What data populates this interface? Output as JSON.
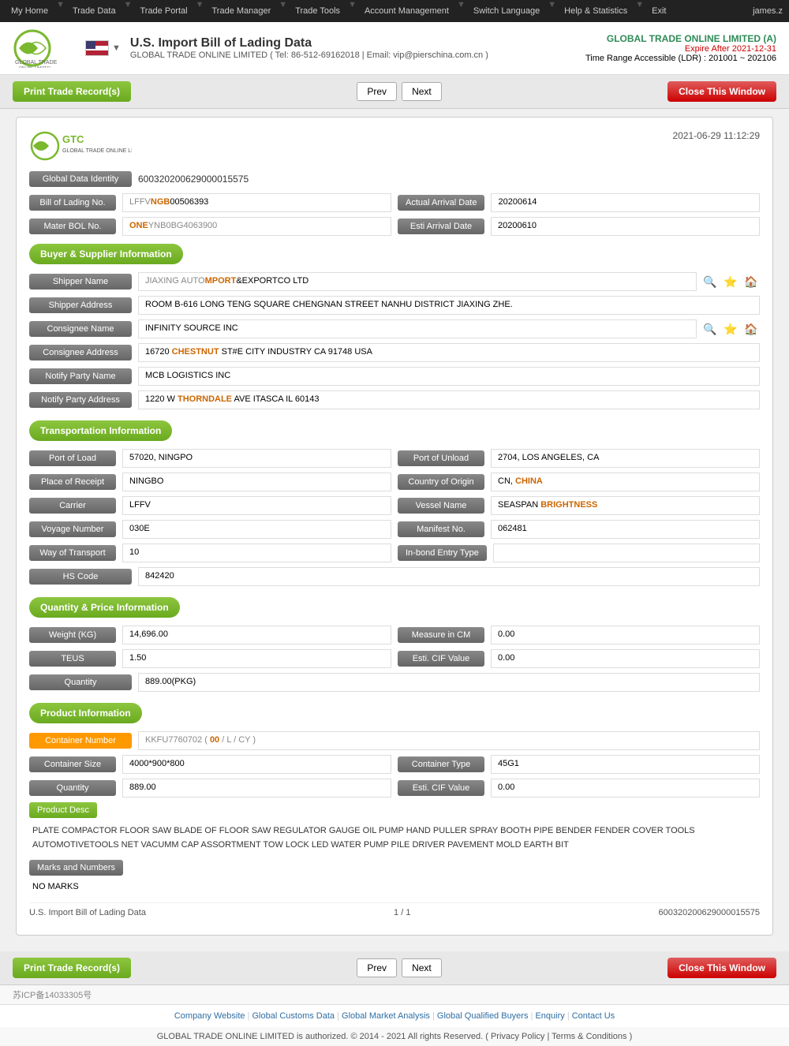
{
  "topNav": {
    "items": [
      {
        "label": "My Home",
        "id": "my-home"
      },
      {
        "label": "Trade Data",
        "id": "trade-data"
      },
      {
        "label": "Trade Portal",
        "id": "trade-portal"
      },
      {
        "label": "Trade Manager",
        "id": "trade-manager"
      },
      {
        "label": "Trade Tools",
        "id": "trade-tools"
      },
      {
        "label": "Account Management",
        "id": "account-management"
      },
      {
        "label": "Switch Language",
        "id": "switch-language"
      },
      {
        "label": "Help & Statistics",
        "id": "help-statistics"
      },
      {
        "label": "Exit",
        "id": "exit"
      }
    ],
    "user": "james.z"
  },
  "header": {
    "title": "U.S. Import Bill of Lading Data",
    "subtitle": "GLOBAL TRADE ONLINE LIMITED ( Tel: 86-512-69162018 | Email: vip@pierschina.com.cn )",
    "company": "GLOBAL TRADE ONLINE LIMITED (A)",
    "expire": "Expire After 2021-12-31",
    "ldr": "Time Range Accessible (LDR) : 201001 ~ 202106"
  },
  "toolbar": {
    "print_label": "Print Trade Record(s)",
    "prev_label": "Prev",
    "next_label": "Next",
    "close_label": "Close This Window"
  },
  "record": {
    "date": "2021-06-29 11:12:29",
    "global_data_identity_label": "Global Data Identity",
    "global_data_identity_value": "600320200629000015575",
    "bill_of_lading_no_label": "Bill of Lading No.",
    "bill_of_lading_no_value": "LFFVNGB00506393",
    "actual_arrival_date_label": "Actual Arrival Date",
    "actual_arrival_date_value": "20200614",
    "mater_bol_no_label": "Mater BOL No.",
    "mater_bol_no_value": "ONEYNB0BG4063900",
    "esti_arrival_date_label": "Esti Arrival Date",
    "esti_arrival_date_value": "20200610"
  },
  "buyerSupplier": {
    "title": "Buyer & Supplier Information",
    "shipper_name_label": "Shipper Name",
    "shipper_name_value": "JIAXING AUTOMPORT&EXPORTCO LTD",
    "shipper_address_label": "Shipper Address",
    "shipper_address_value": "ROOM B-616 LONG TENG SQUARE CHENGNAN STREET NANHU DISTRICT JIAXING ZHE.",
    "consignee_name_label": "Consignee Name",
    "consignee_name_value": "INFINITY SOURCE INC",
    "consignee_address_label": "Consignee Address",
    "consignee_address_value": "16720 CHESTNUT ST#E CITY INDUSTRY CA 91748 USA",
    "notify_party_name_label": "Notify Party Name",
    "notify_party_name_value": "MCB LOGISTICS INC",
    "notify_party_address_label": "Notify Party Address",
    "notify_party_address_value": "1220 W THORNDALE AVE ITASCA IL 60143"
  },
  "transportation": {
    "title": "Transportation Information",
    "port_of_load_label": "Port of Load",
    "port_of_load_value": "57020, NINGPO",
    "port_of_unload_label": "Port of Unload",
    "port_of_unload_value": "2704, LOS ANGELES, CA",
    "place_of_receipt_label": "Place of Receipt",
    "place_of_receipt_value": "NINGBO",
    "country_of_origin_label": "Country of Origin",
    "country_of_origin_value": "CN, CHINA",
    "carrier_label": "Carrier",
    "carrier_value": "LFFV",
    "vessel_name_label": "Vessel Name",
    "vessel_name_value": "SEASPAN BRIGHTNESS",
    "voyage_number_label": "Voyage Number",
    "voyage_number_value": "030E",
    "manifest_no_label": "Manifest No.",
    "manifest_no_value": "062481",
    "way_of_transport_label": "Way of Transport",
    "way_of_transport_value": "10",
    "in_bond_entry_type_label": "In-bond Entry Type",
    "in_bond_entry_type_value": "",
    "hs_code_label": "HS Code",
    "hs_code_value": "842420"
  },
  "quantityPrice": {
    "title": "Quantity & Price Information",
    "weight_label": "Weight (KG)",
    "weight_value": "14,696.00",
    "measure_in_cm_label": "Measure in CM",
    "measure_in_cm_value": "0.00",
    "teus_label": "TEUS",
    "teus_value": "1.50",
    "esti_cif_value_label": "Esti. CIF Value",
    "esti_cif_value_1": "0.00",
    "quantity_label": "Quantity",
    "quantity_value": "889.00(PKG)"
  },
  "productInfo": {
    "title": "Product Information",
    "container_number_label": "Container Number",
    "container_number_value": "KKFU7760702 ( 00 / L / CY )",
    "container_size_label": "Container Size",
    "container_size_value": "4000*900*800",
    "container_type_label": "Container Type",
    "container_type_value": "45G1",
    "quantity_label": "Quantity",
    "quantity_value": "889.00",
    "esti_cif_value_label": "Esti. CIF Value",
    "esti_cif_value": "0.00",
    "product_desc_label": "Product Desc",
    "product_desc_value": "PLATE COMPACTOR FLOOR SAW BLADE OF FLOOR SAW REGULATOR GAUGE OIL PUMP HAND PULLER SPRAY BOOTH PIPE BENDER FENDER COVER TOOLS AUTOMOTIVETOOLS NET VACUMM CAP ASSORTMENT TOW LOCK LED WATER PUMP PILE DRIVER PAVEMENT MOLD EARTH BIT",
    "marks_label": "Marks and Numbers",
    "marks_value": "NO MARKS"
  },
  "bottomInfo": {
    "source": "U.S. Import Bill of Lading Data",
    "page": "1 / 1",
    "record_id": "600320200629000015575"
  },
  "footer": {
    "links": [
      {
        "label": "Company Website",
        "id": "company-website"
      },
      {
        "label": "Global Customs Data",
        "id": "global-customs"
      },
      {
        "label": "Global Market Analysis",
        "id": "global-market"
      },
      {
        "label": "Global Qualified Buyers",
        "id": "global-buyers"
      },
      {
        "label": "Enquiry",
        "id": "enquiry"
      },
      {
        "label": "Contact Us",
        "id": "contact-us"
      }
    ],
    "copyright": "GLOBAL TRADE ONLINE LIMITED is authorized. © 2014 - 2021 All rights Reserved.  ( Privacy Policy | Terms & Conditions )",
    "icp": "苏ICP备14033305号"
  },
  "colors": {
    "green": "#7ab82e",
    "orange": "#ff9900",
    "red": "#cc0000",
    "label_bg": "#777"
  }
}
